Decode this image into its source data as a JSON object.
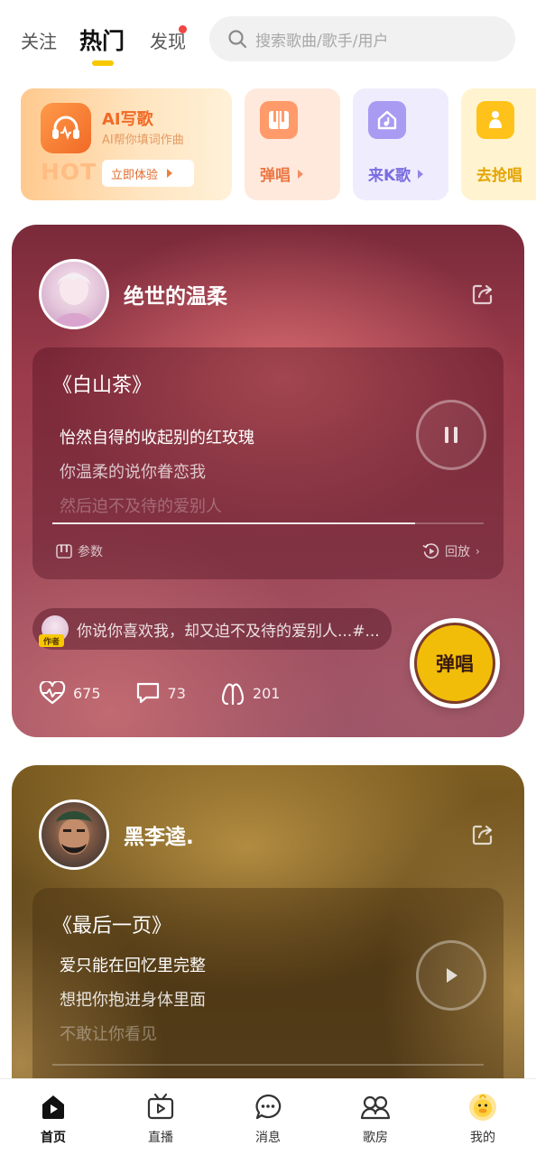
{
  "nav": {
    "tabs": [
      "关注",
      "热门",
      "发现"
    ],
    "active_tab": "热门",
    "search_placeholder": "搜索歌曲/歌手/用户"
  },
  "features": {
    "ai": {
      "title": "AI写歌",
      "subtitle": "AI帮你填词作曲",
      "badge": "HOT",
      "button": "立即体验"
    },
    "items": [
      {
        "label": "弹唱",
        "icon": "piano-icon"
      },
      {
        "label": "来K歌",
        "icon": "music-note-icon"
      },
      {
        "label": "去抢唱",
        "icon": "grab-hand-icon"
      }
    ]
  },
  "cards": [
    {
      "username": "绝世的温柔",
      "song": "《白山茶》",
      "lyrics": [
        "怡然自得的收起别的红玫瑰",
        "你温柔的说你眷恋我",
        "然后迫不及待的爱别人"
      ],
      "state": "playing",
      "progress": 0.84,
      "params_label": "参数",
      "replay_label": "回放",
      "comment": {
        "badge": "作者",
        "text": "你说你喜欢我，却又迫不及待的爱别人...#..."
      },
      "stats": {
        "likes": "675",
        "comments": "73",
        "gifts": "201"
      },
      "sing_button": "弹唱",
      "colors": {
        "sing_button": "#f2bd08"
      }
    },
    {
      "username": "黑李逵.",
      "song": "《最后一页》",
      "lyrics": [
        "爱只能在回忆里完整",
        "想把你抱进身体里面",
        "不敢让你看见"
      ],
      "state": "paused"
    }
  ],
  "bottom_tabs": [
    {
      "label": "首页",
      "icon": "home-play-icon",
      "active": true
    },
    {
      "label": "直播",
      "icon": "live-tv-icon",
      "active": false
    },
    {
      "label": "消息",
      "icon": "message-bubble-icon",
      "active": false
    },
    {
      "label": "歌房",
      "icon": "people-room-icon",
      "active": false
    },
    {
      "label": "我的",
      "icon": "duck-avatar-icon",
      "active": false
    }
  ],
  "colors": {
    "accent": "#f7c800",
    "notify_dot": "#f04545"
  }
}
